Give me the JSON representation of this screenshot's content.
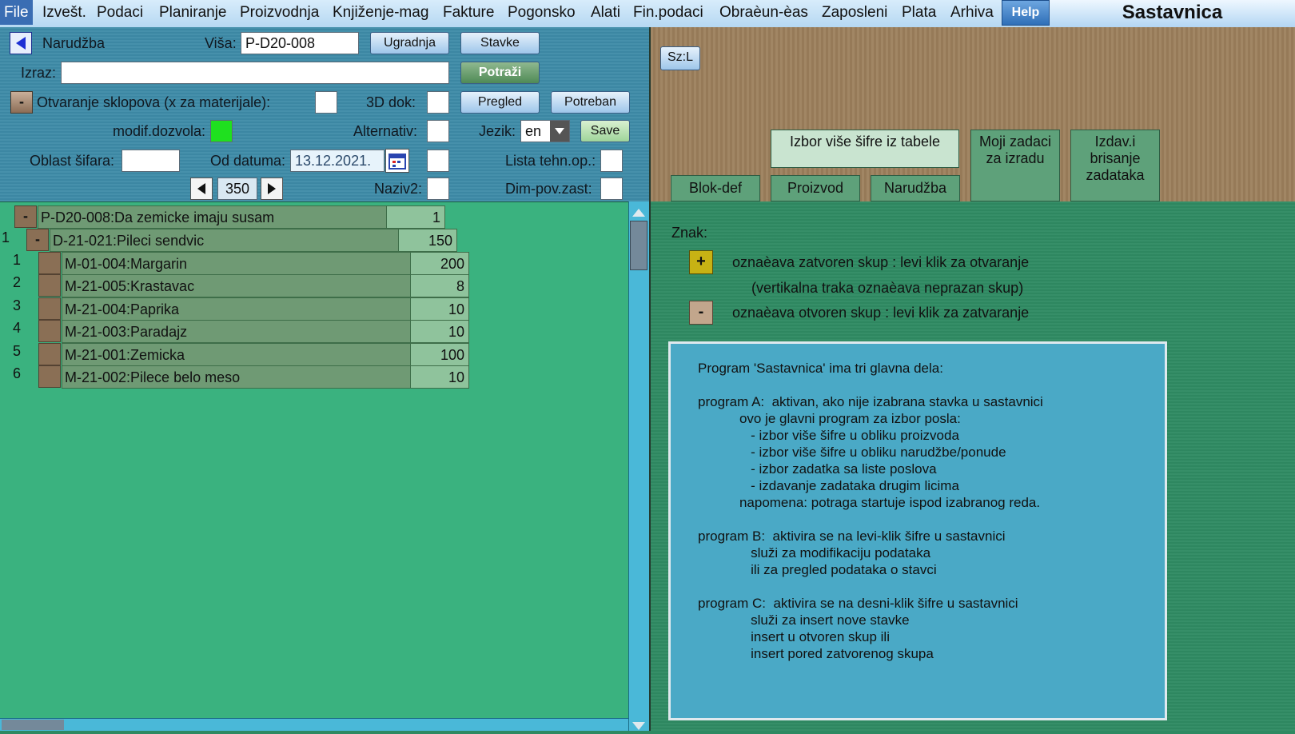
{
  "menu": {
    "items": [
      "File",
      "Izvešt.",
      "Podaci",
      "Planiranje",
      "Proizvodnja",
      "Knjiženje-mag",
      "Fakture",
      "Pogonsko",
      "Alati",
      "Fin.podaci",
      "Obraèun-èas",
      "Zaposleni",
      "Plata",
      "Arhiva"
    ],
    "help": "Help",
    "app_title": "Sastavnica"
  },
  "toolbar": {
    "narudzba_label": "Narudžba",
    "visa_label": "Viša:",
    "visa_value": "P-D20-008",
    "ugradnja_button": "Ugradnja",
    "stavke_button": "Stavke",
    "izraz_label": "Izraz:",
    "izraz_value": "",
    "potrazi_button": "Potraži",
    "collapse_button": "-",
    "otvaranje_label": "Otvaranje sklopova (x za materijale):",
    "dok3d_label": "3D dok:",
    "pregled_button": "Pregled",
    "potreban_button": "Potreban",
    "modif_label": "modif.dozvola:",
    "alternativ_label": "Alternativ:",
    "jezik_label": "Jezik:",
    "jezik_value": "en",
    "save_button": "Save",
    "oblast_label": "Oblast šifara:",
    "oblast_value": "",
    "od_datuma_label": "Od datuma:",
    "od_datuma_value": "13.12.2021.",
    "lista_label": "Lista tehn.op.:",
    "page_value": "350",
    "naziv2_label": "Naziv2:",
    "dim_label": "Dim-pov.zast:"
  },
  "tree": {
    "root": {
      "expander": "-",
      "name": "P-D20-008:Da zemicke imaju susam",
      "qty": "1"
    },
    "sub": {
      "num": "1",
      "expander": "-",
      "name": "D-21-021:Pileci sendvic",
      "qty": "150"
    },
    "items": [
      {
        "num": "1",
        "name": "M-01-004:Margarin",
        "qty": "200"
      },
      {
        "num": "2",
        "name": "M-21-005:Krastavac",
        "qty": "8"
      },
      {
        "num": "3",
        "name": "M-21-004:Paprika",
        "qty": "10"
      },
      {
        "num": "4",
        "name": "M-21-003:Paradajz",
        "qty": "10"
      },
      {
        "num": "5",
        "name": "M-21-001:Zemicka",
        "qty": "100"
      },
      {
        "num": "6",
        "name": "M-21-002:Pilece belo meso",
        "qty": "10"
      }
    ]
  },
  "right_top": {
    "szl_button": "Sz:L",
    "tabs": {
      "izbor": "Izbor više šifre iz tabele",
      "moji_zadaci": [
        "Moji zadaci",
        "za izradu"
      ],
      "izdav": [
        "Izdav.i",
        "brisanje",
        "zadataka"
      ],
      "blok_def": "Blok-def",
      "proizvod": "Proizvod",
      "narudzba": "Narudžba"
    }
  },
  "legend": {
    "title": "Znak:",
    "plus_symbol": "+",
    "minus_symbol": "-",
    "closed_text": "oznaèava zatvoren skup : levi klik za otvaranje",
    "vertical_text": "(vertikalna traka oznaèava neprazan skup)",
    "open_text": "oznaèava otvoren skup : levi klik za zatvaranje"
  },
  "info_lines": [
    "Program 'Sastavnica' ima tri glavna dela:",
    "",
    "program A:  aktivan, ako nije izabrana stavka u sastavnici",
    "           ovo je glavni program za izbor posla:",
    "              - izbor više šifre u obliku proizvoda",
    "              - izbor više šifre u obliku narudžbe/ponude",
    "              - izbor zadatka sa liste poslova",
    "              - izdavanje zadataka drugim licima",
    "           napomena: potraga startuje ispod izabranog reda.",
    "",
    "program B:  aktivira se na levi-klik šifre u sastavnici",
    "              služi za modifikaciju podataka",
    "              ili za pregled podataka o stavci",
    "",
    "program C:  aktivira se na desni-klik šifre u sastavnici",
    "              služi za insert nove stavke",
    "              insert u otvoren skup ili",
    "              insert pored zatvorenog skupa"
  ],
  "colors": {
    "modif_indicator": "#1fe01f",
    "tree_bg": "#3ab27f",
    "toolbar_bg": "#3e8ba8",
    "wood_bg": "#9c7f5c"
  }
}
